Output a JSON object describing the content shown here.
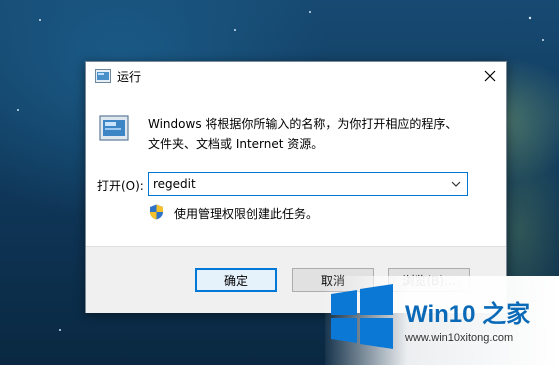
{
  "dialog": {
    "title": "运行",
    "description_line1": "Windows 将根据你所输入的名称，为你打开相应的程序、",
    "description_line2": "文件夹、文档或 Internet 资源。",
    "open_label": "打开(O):",
    "input_value": "regedit",
    "admin_note": "使用管理权限创建此任务。",
    "buttons": {
      "ok": "确定",
      "cancel": "取消",
      "browse": "浏览(B)..."
    },
    "icons": [
      "run-icon",
      "close-icon",
      "run-large-icon",
      "dropdown-arrow-icon",
      "uac-shield-icon"
    ]
  },
  "watermark": {
    "brand": "Win10 之家",
    "url": "www.win10xitong.com",
    "logo": "windows-logo"
  },
  "colors": {
    "accent": "#0078d7",
    "brand": "#0a6ab8",
    "desktop": "#0f3557"
  }
}
